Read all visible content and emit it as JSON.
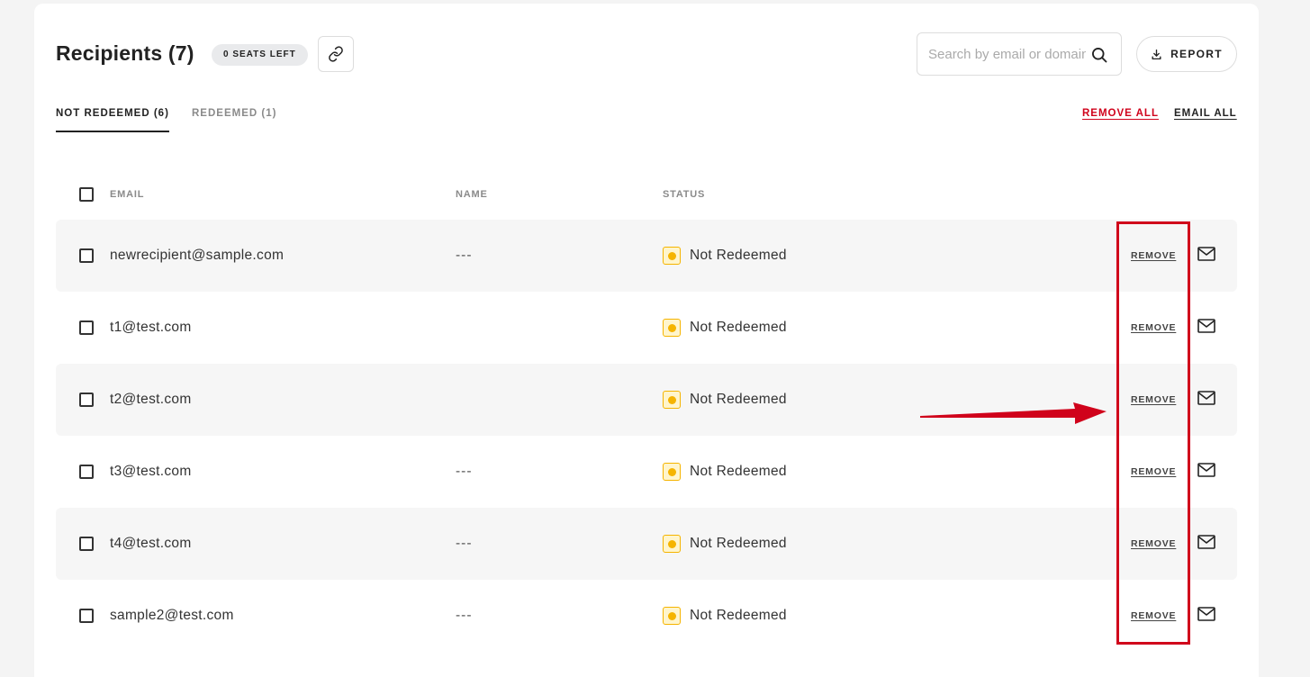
{
  "header": {
    "title": "Recipients (7)",
    "seats_badge": "0 SEATS LEFT",
    "search_placeholder": "Search by email or domain",
    "report_label": "REPORT"
  },
  "tabs": [
    {
      "label": "NOT REDEEMED (6)",
      "active": true
    },
    {
      "label": "REDEEMED (1)",
      "active": false
    }
  ],
  "bulk_actions": {
    "remove_all": "REMOVE ALL",
    "email_all": "EMAIL ALL"
  },
  "table": {
    "columns": [
      "EMAIL",
      "NAME",
      "STATUS"
    ],
    "rows": [
      {
        "email": "newrecipient@sample.com",
        "name": "---",
        "status": "Not Redeemed",
        "action": "REMOVE"
      },
      {
        "email": "t1@test.com",
        "name": "",
        "status": "Not Redeemed",
        "action": "REMOVE"
      },
      {
        "email": "t2@test.com",
        "name": "",
        "status": "Not Redeemed",
        "action": "REMOVE"
      },
      {
        "email": "t3@test.com",
        "name": "---",
        "status": "Not Redeemed",
        "action": "REMOVE"
      },
      {
        "email": "t4@test.com",
        "name": "---",
        "status": "Not Redeemed",
        "action": "REMOVE"
      },
      {
        "email": "sample2@test.com",
        "name": "---",
        "status": "Not Redeemed",
        "action": "REMOVE"
      }
    ]
  },
  "colors": {
    "accent_red": "#d0021b",
    "status_yellow": "#f5b400",
    "text_dark": "#222222"
  },
  "icons": [
    "link-icon",
    "search-icon",
    "download-icon",
    "mail-icon",
    "annotation-arrow"
  ]
}
